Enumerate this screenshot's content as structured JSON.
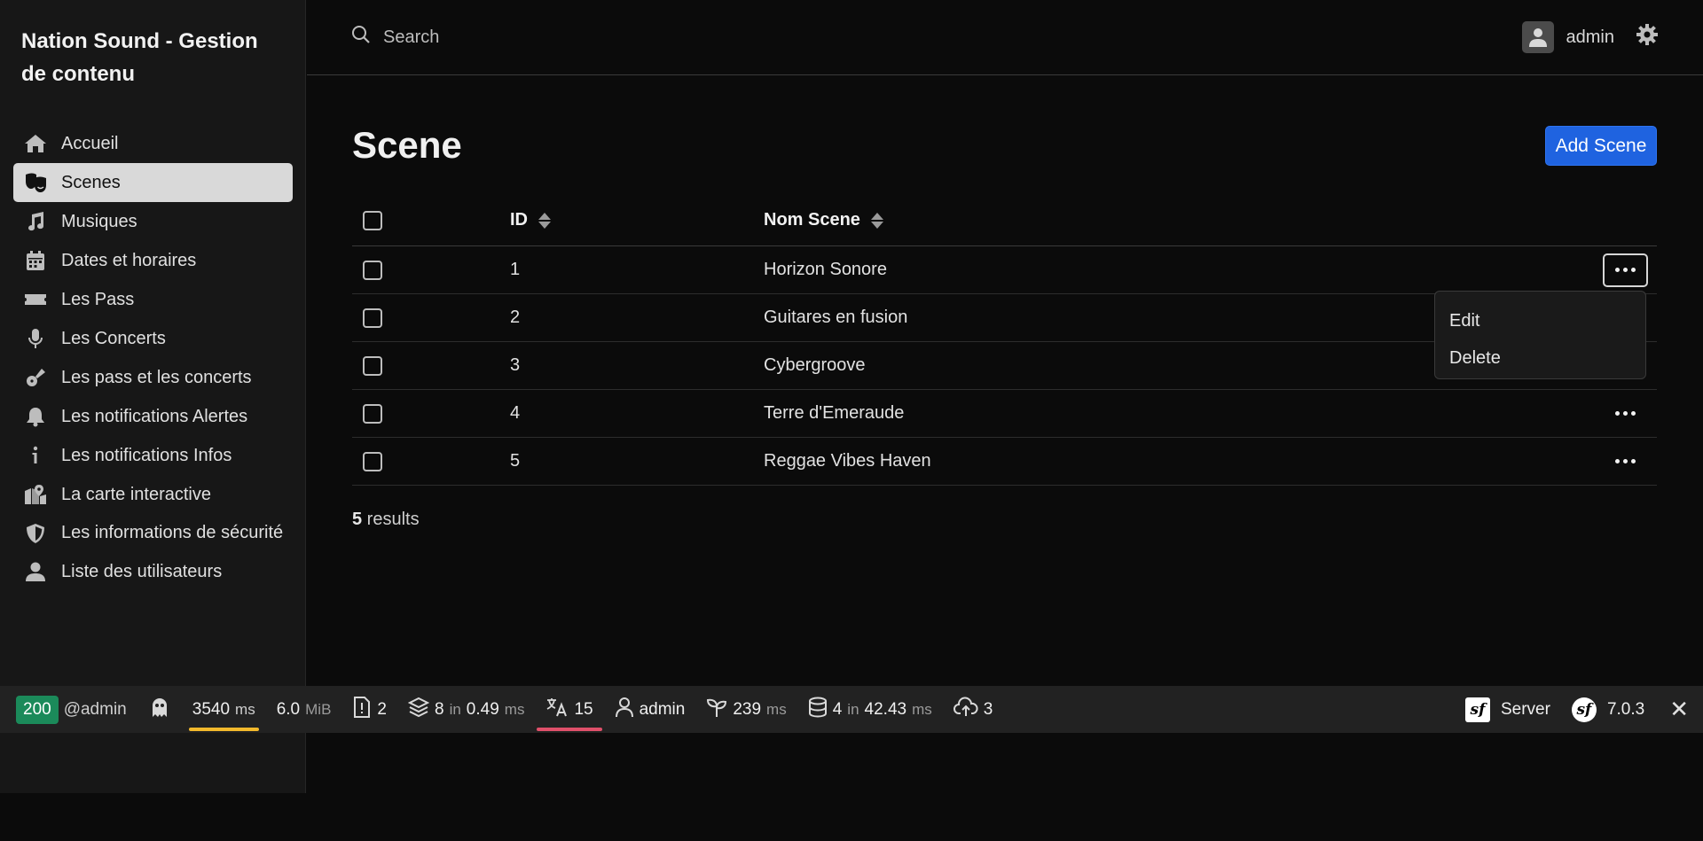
{
  "app": {
    "title": "Nation Sound - Gestion de contenu"
  },
  "sidebar": {
    "items": [
      {
        "label": "Accueil",
        "icon": "home-icon",
        "active": false
      },
      {
        "label": "Scenes",
        "icon": "theater-masks-icon",
        "active": true
      },
      {
        "label": "Musiques",
        "icon": "music-note-icon",
        "active": false
      },
      {
        "label": "Dates et horaires",
        "icon": "calendar-icon",
        "active": false
      },
      {
        "label": "Les Pass",
        "icon": "ticket-icon",
        "active": false
      },
      {
        "label": "Les Concerts",
        "icon": "microphone-icon",
        "active": false
      },
      {
        "label": "Les pass et les concerts",
        "icon": "guitar-icon",
        "active": false
      },
      {
        "label": "Les notifications Alertes",
        "icon": "bell-icon",
        "active": false
      },
      {
        "label": "Les notifications Infos",
        "icon": "info-icon",
        "active": false
      },
      {
        "label": "La carte interactive",
        "icon": "map-location-icon",
        "active": false
      },
      {
        "label": "Les informations de sécurité",
        "icon": "shield-icon",
        "active": false
      },
      {
        "label": "Liste des utilisateurs",
        "icon": "user-icon",
        "active": false
      }
    ]
  },
  "header": {
    "search_placeholder": "Search",
    "username": "admin"
  },
  "main": {
    "title": "Scene",
    "add_button": "Add Scene",
    "columns": {
      "id": "ID",
      "name": "Nom Scene"
    },
    "rows": [
      {
        "id": "1",
        "name": "Horizon Sonore"
      },
      {
        "id": "2",
        "name": "Guitares en fusion"
      },
      {
        "id": "3",
        "name": "Cybergroove"
      },
      {
        "id": "4",
        "name": "Terre d'Emeraude"
      },
      {
        "id": "5",
        "name": "Reggae Vibes Haven"
      }
    ],
    "dropdown": {
      "edit": "Edit",
      "delete": "Delete"
    },
    "results_count": "5",
    "results_label": " results"
  },
  "toolbar": {
    "status": "200",
    "route_user": "@admin",
    "time_value": "3540",
    "time_unit": "ms",
    "memory_value": "6.0",
    "memory_unit": "MiB",
    "logs": "2",
    "cache_count": "8",
    "cache_in": "in",
    "cache_time": "0.49",
    "cache_unit": "ms",
    "translations": "15",
    "user": "admin",
    "twig_time": "239",
    "twig_unit": "ms",
    "db_queries": "4",
    "db_in": "in",
    "db_time": "42.43",
    "db_unit": "ms",
    "uploads": "3",
    "server_label": "Server",
    "symfony_version": "7.0.3",
    "colors": {
      "status": "#1b8a5a",
      "time_bar": "#f2b92c",
      "translation_bar": "#e0506a"
    }
  },
  "colors": {
    "accent": "#1f63e0",
    "active_nav": "#d9d9d9"
  }
}
